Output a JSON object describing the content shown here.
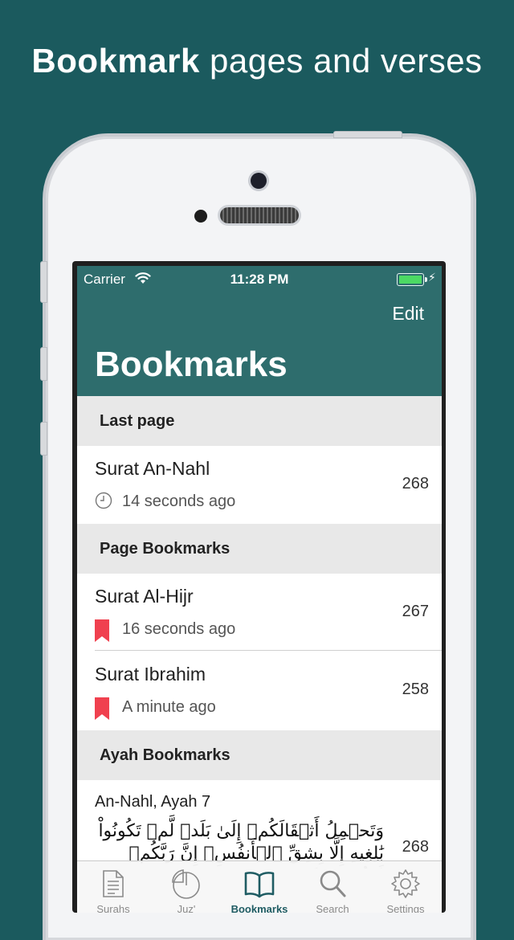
{
  "headline": {
    "bold": "Bookmark",
    "rest": "pages and verses"
  },
  "status_bar": {
    "carrier": "Carrier",
    "time": "11:28 PM"
  },
  "nav": {
    "edit": "Edit",
    "title": "Bookmarks"
  },
  "sections": {
    "last_page": "Last page",
    "page_bookmarks": "Page Bookmarks",
    "ayah_bookmarks": "Ayah Bookmarks"
  },
  "last_page": {
    "title": "Surat An-Nahl",
    "time": "14 seconds ago",
    "page": "268",
    "icon": "clock-icon"
  },
  "page_bookmarks": [
    {
      "title": "Surat Al-Hijr",
      "time": "16 seconds ago",
      "page": "267",
      "icon": "bookmark-icon"
    },
    {
      "title": "Surat Ibrahim",
      "time": "A minute ago",
      "page": "258",
      "icon": "bookmark-icon"
    }
  ],
  "ayah_bookmarks": [
    {
      "ref": "An-Nahl, Ayah 7",
      "text": "وَتَحۡمِلُ أَثۡقَالَكُمۡ إِلَىٰ بَلَدٖ لَّمۡ تَكُونُواْ بَٰلِغِيهِ إِلَّا بِشِقِّ ٱلۡأَنفُسِۚ إِنَّ رَبَّكُمۡ لَرَءُوفٞ رَّحِيمٞ",
      "page": "268"
    }
  ],
  "tabs": [
    {
      "label": "Surahs",
      "icon": "document-icon"
    },
    {
      "label": "Juz'",
      "icon": "pie-icon"
    },
    {
      "label": "Bookmarks",
      "icon": "book-icon",
      "active": true
    },
    {
      "label": "Search",
      "icon": "search-icon"
    },
    {
      "label": "Settings",
      "icon": "gear-icon"
    }
  ],
  "colors": {
    "background": "#1b5a5e",
    "nav": "#2e6d6d",
    "bookmark_red": "#f0414f",
    "tab_active": "#1f5c63"
  }
}
